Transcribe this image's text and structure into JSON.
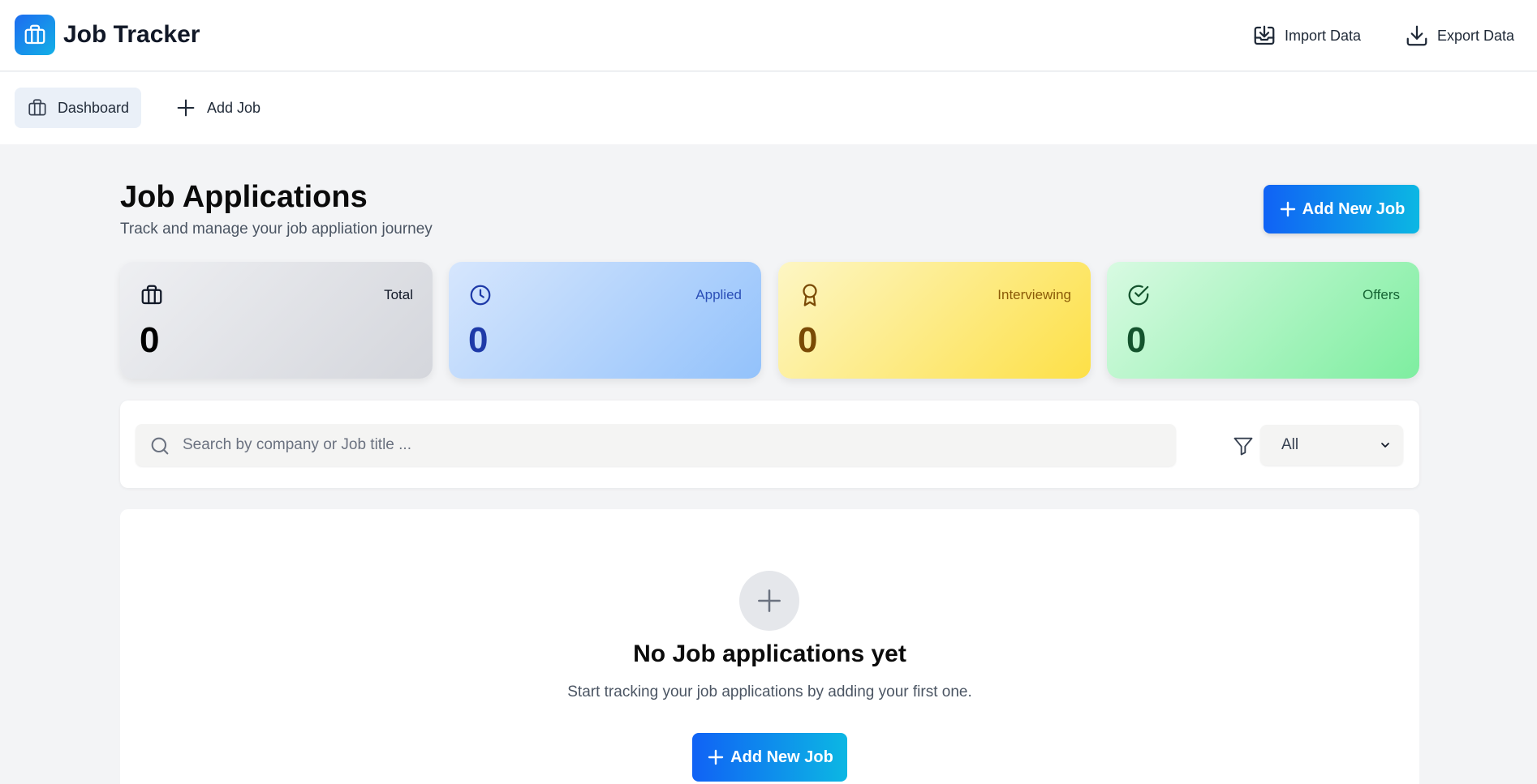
{
  "app": {
    "title": "Job Tracker"
  },
  "header": {
    "import_label": "Import Data",
    "export_label": "Export Data"
  },
  "nav": {
    "items": [
      {
        "label": "Dashboard",
        "icon": "briefcase-icon",
        "active": true
      },
      {
        "label": "Add Job",
        "icon": "plus-icon",
        "active": false
      }
    ]
  },
  "main": {
    "title": "Job Applications",
    "subtitle": "Track and manage your job appliation journey",
    "add_button_label": "Add New Job"
  },
  "stats": [
    {
      "label": "Total",
      "value": "0",
      "icon": "briefcase-icon",
      "color": "#111827"
    },
    {
      "label": "Applied",
      "value": "0",
      "icon": "clock-icon",
      "color": "#1e3aa8"
    },
    {
      "label": "Interviewing",
      "value": "0",
      "icon": "award-icon",
      "color": "#7a4a05"
    },
    {
      "label": "Offers",
      "value": "0",
      "icon": "check-circle-icon",
      "color": "#14532d"
    }
  ],
  "filters": {
    "search_placeholder": "Search by company or Job title ...",
    "status_selected": "All"
  },
  "empty_state": {
    "title": "No Job applications yet",
    "subtitle": "Start tracking your job applications by adding your first one.",
    "button_label": "Add New Job"
  },
  "colors": {
    "accent_start": "#1062f5",
    "accent_end": "#0cb7e3"
  }
}
